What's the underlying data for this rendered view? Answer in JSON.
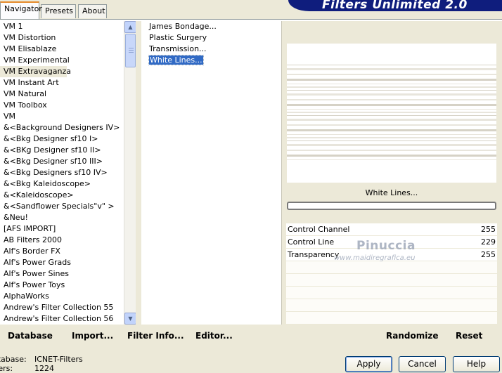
{
  "tabs": [
    {
      "label": "Navigator",
      "active": true
    },
    {
      "label": "Presets",
      "active": false
    },
    {
      "label": "About",
      "active": false
    }
  ],
  "banner_title": "Filters Unlimited 2.0",
  "categories": [
    "VM 1",
    "VM Distortion",
    "VM Elisablaze",
    "VM Experimental",
    "VM Extravaganza",
    "VM Instant Art",
    "VM Natural",
    "VM Toolbox",
    "VM",
    "&<Background Designers IV>",
    "&<Bkg Designer sf10 I>",
    "&<BKg Designer sf10 II>",
    "&<Bkg Designer sf10 III>",
    "&<Bkg Designers sf10 IV>",
    "&<Bkg Kaleidoscope>",
    "&<Kaleidoscope>",
    "&<Sandflower Specials\"v\" >",
    "&Neu!",
    "[AFS IMPORT]",
    "AB Filters 2000",
    "Alf's Border FX",
    "Alf's Power Grads",
    "Alf's Power Sines",
    "Alf's Power Toys",
    "AlphaWorks",
    "Andrew's Filter Collection 55",
    "Andrew's Filter Collection 56"
  ],
  "selected_category_index": 4,
  "filters": [
    "James Bondage...",
    "Plastic Surgery",
    "Transmission...",
    "White Lines..."
  ],
  "selected_filter_index": 3,
  "preview_label": "White Lines...",
  "progress": 0,
  "controls": [
    {
      "label": "Control Channel",
      "value": "255"
    },
    {
      "label": "Control Line",
      "value": "229"
    },
    {
      "label": "Transparency",
      "value": "255"
    }
  ],
  "watermark": {
    "title": "Pinuccia",
    "subtitle": "www.maidiregrafica.eu"
  },
  "toolbar": {
    "database": "Database",
    "import": "Import...",
    "filter_info": "Filter Info...",
    "editor": "Editor...",
    "randomize": "Randomize",
    "reset": "Reset"
  },
  "status": {
    "database_key": "atabase:",
    "database_value": "ICNET-Filters",
    "filters_key": "lters:",
    "filters_value": "1224"
  },
  "buttons": {
    "apply": "Apply",
    "cancel": "Cancel",
    "help": "Help"
  },
  "colors": {
    "selection": "#316ac5",
    "banner": "#0f1d7d",
    "dialog_bg": "#ece9d8",
    "active_tab_accent": "#e68b2c"
  }
}
